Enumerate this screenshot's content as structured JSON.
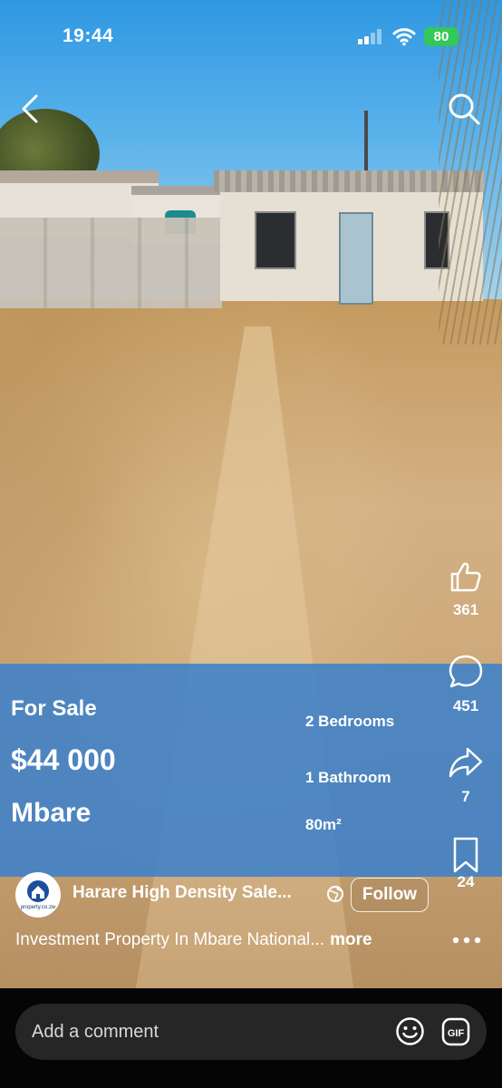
{
  "status_bar": {
    "time": "19:44",
    "battery": "80"
  },
  "listing": {
    "status": "For Sale",
    "price": "$44 000",
    "location": "Mbare",
    "bedrooms": "2 Bedrooms",
    "bathrooms": "1 Bathroom",
    "size": "80m²"
  },
  "actions": {
    "likes": "361",
    "comments": "451",
    "shares": "7",
    "saves": "24"
  },
  "author": {
    "avatar_text": "property.co.zw",
    "name": "Harare High Density Sale...",
    "follow_label": "Follow"
  },
  "caption": {
    "text": "Investment Property In Mbare National...",
    "more_label": "more"
  },
  "comment_bar": {
    "placeholder": "Add a comment"
  },
  "colors": {
    "overlay": "#3a80cc",
    "battery": "#34c759",
    "comment_bg": "#262626"
  },
  "icons": [
    "back-icon",
    "search-icon",
    "thumbs-up-icon",
    "comment-icon",
    "share-icon",
    "bookmark-icon",
    "globe-icon",
    "more-icon",
    "emoji-icon",
    "gif-icon"
  ]
}
